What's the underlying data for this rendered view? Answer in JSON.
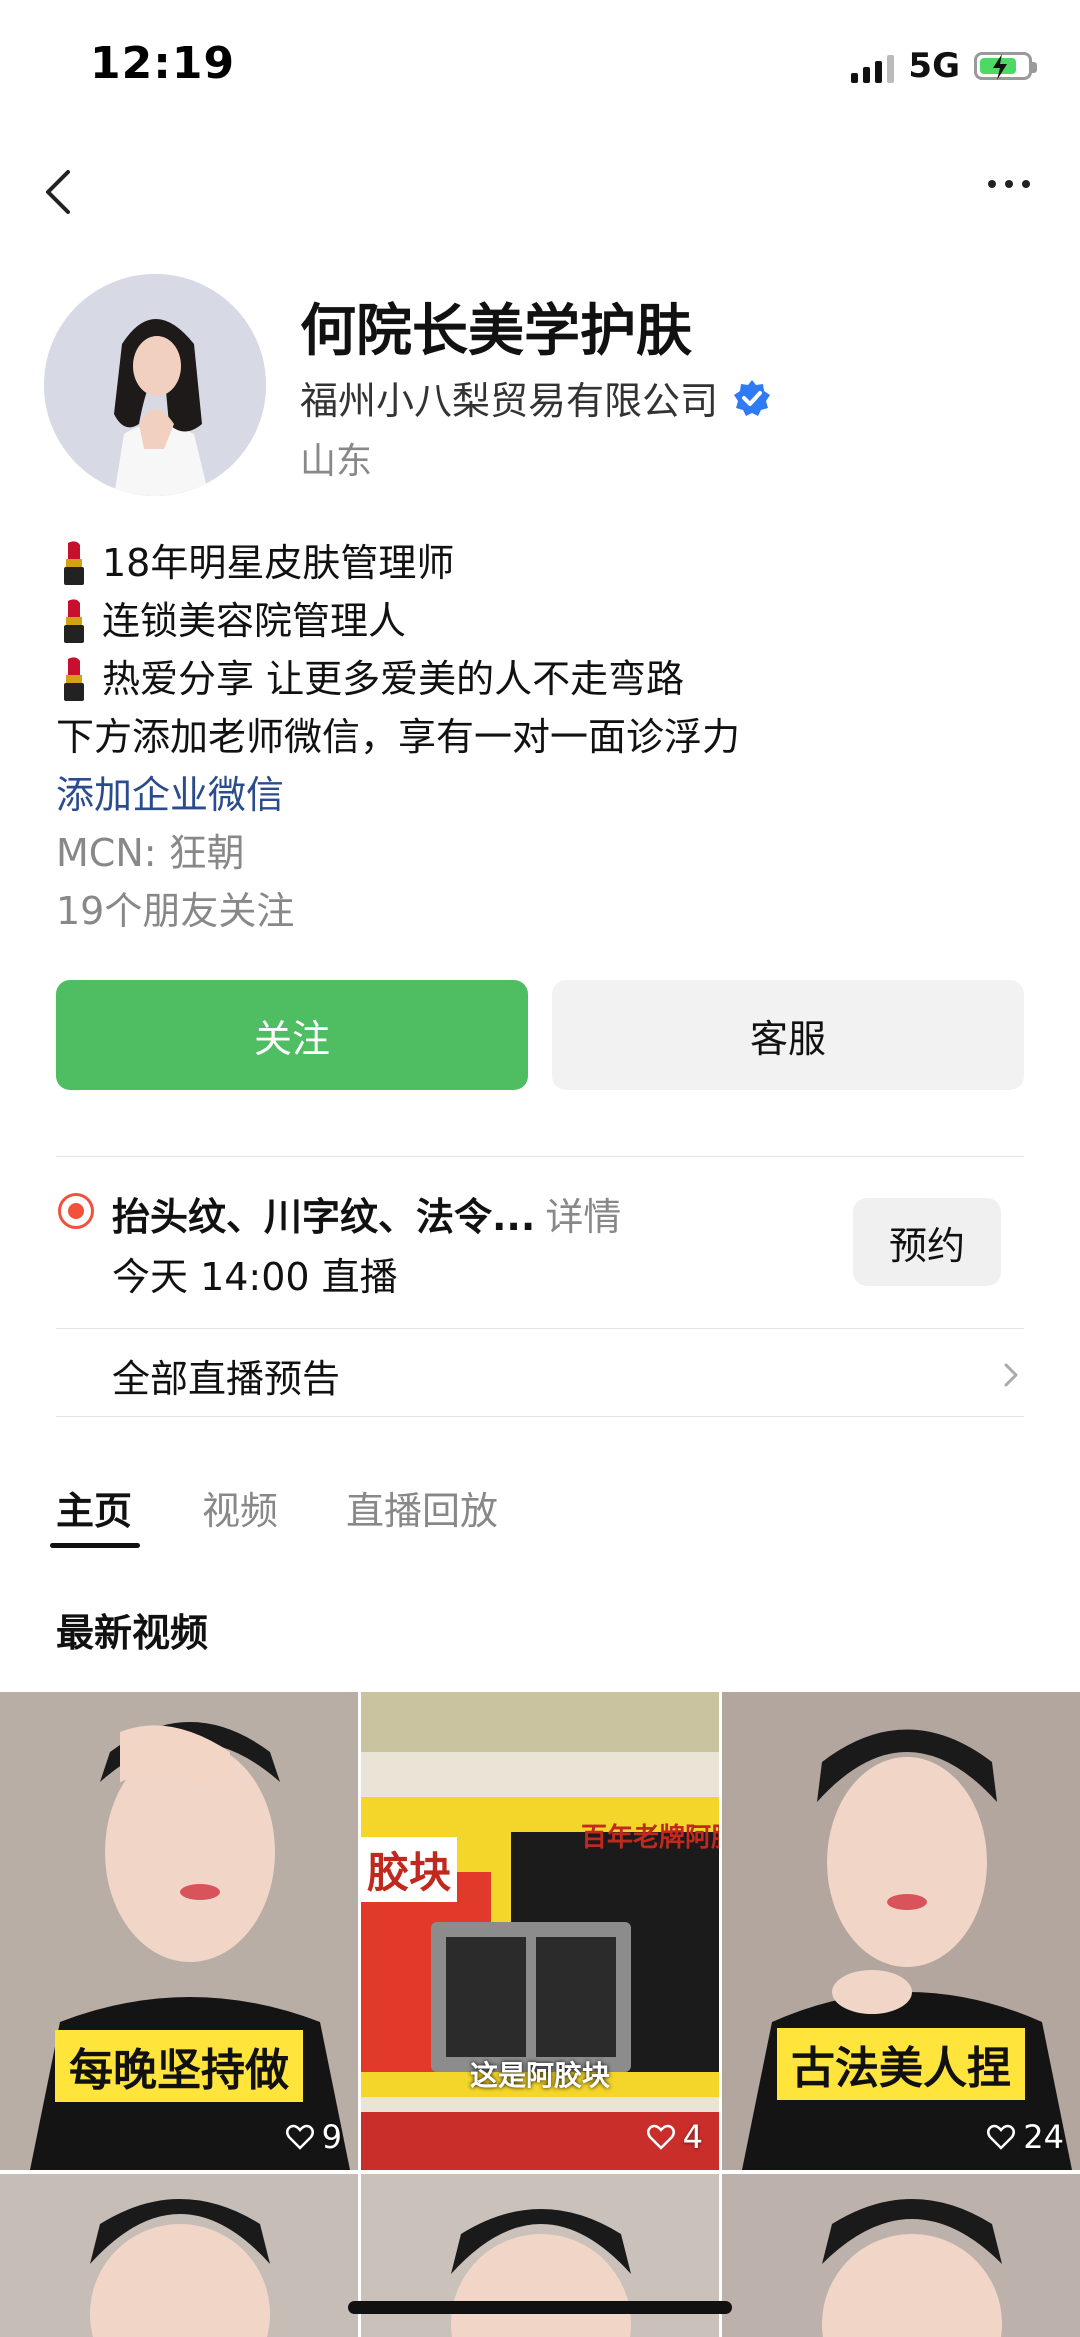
{
  "status": {
    "time": "12:19",
    "network": "5G"
  },
  "profile": {
    "name": "何院长美学护肤",
    "company": "福州小八梨贸易有限公司",
    "region": "山东",
    "bio": [
      "18年明星皮肤管理师",
      "连锁美容院管理人",
      "热爱分享 让更多爱美的人不走弯路"
    ],
    "bio_note": "下方添加老师微信，享有一对一面诊浮力",
    "add_wechat": "添加企业微信",
    "mcn": "MCN: 狂朝",
    "friends_follow": "19个朋友关注"
  },
  "actions": {
    "follow": "关注",
    "service": "客服"
  },
  "live": {
    "title": "抬头纹、川字纹、法令...",
    "detail": "详情",
    "time": "今天 14:00 直播",
    "reserve": "预约",
    "all_previews": "全部直播预告"
  },
  "tabs": [
    "主页",
    "视频",
    "直播回放"
  ],
  "section_title": "最新视频",
  "videos": [
    {
      "caption": "每晚坚持做",
      "likes": "9"
    },
    {
      "caption": "这是阿胶块",
      "banner": "胶块",
      "banner2": "百年老牌阿胶",
      "likes": "4"
    },
    {
      "caption": "古法美人捏",
      "likes": "24"
    }
  ],
  "colors": {
    "follow_green": "#4fbe62",
    "link_blue": "#2b4c8c",
    "verified_blue": "#2f7bf5",
    "live_red": "#f0523d"
  }
}
